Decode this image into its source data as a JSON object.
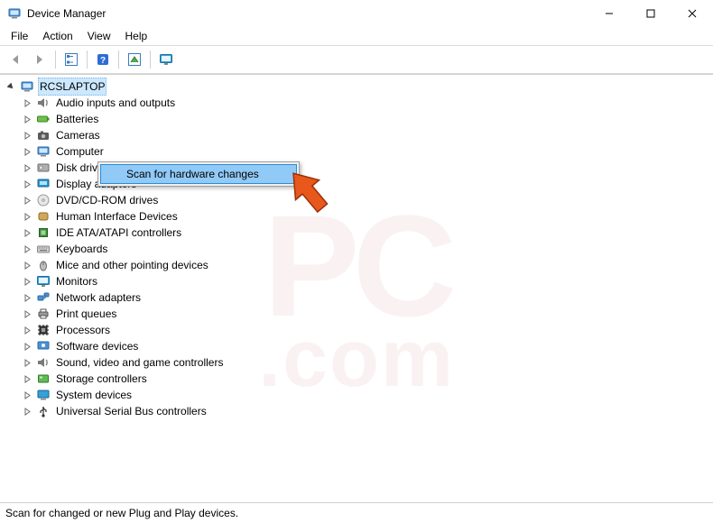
{
  "window": {
    "title": "Device Manager"
  },
  "menu": {
    "file": "File",
    "action": "Action",
    "view": "View",
    "help": "Help"
  },
  "toolbar": {
    "back": "back",
    "forward": "forward",
    "show_hide": "show-hide-tree",
    "help": "help",
    "scan": "scan-hardware",
    "monitor": "add-legacy"
  },
  "tree": {
    "root": "RCSLAPTOP",
    "items": [
      {
        "label": "Audio inputs and outputs",
        "icon": "speaker-icon"
      },
      {
        "label": "Batteries",
        "icon": "battery-icon"
      },
      {
        "label": "Cameras",
        "icon": "camera-icon"
      },
      {
        "label": "Computer",
        "icon": "computer-icon"
      },
      {
        "label": "Disk drives",
        "icon": "disk-icon"
      },
      {
        "label": "Display adapters",
        "icon": "display-adapter-icon"
      },
      {
        "label": "DVD/CD-ROM drives",
        "icon": "optical-drive-icon"
      },
      {
        "label": "Human Interface Devices",
        "icon": "hid-icon"
      },
      {
        "label": "IDE ATA/ATAPI controllers",
        "icon": "ide-controller-icon"
      },
      {
        "label": "Keyboards",
        "icon": "keyboard-icon"
      },
      {
        "label": "Mice and other pointing devices",
        "icon": "mouse-icon"
      },
      {
        "label": "Monitors",
        "icon": "monitor-icon"
      },
      {
        "label": "Network adapters",
        "icon": "network-adapter-icon"
      },
      {
        "label": "Print queues",
        "icon": "printer-icon"
      },
      {
        "label": "Processors",
        "icon": "processor-icon"
      },
      {
        "label": "Software devices",
        "icon": "software-device-icon"
      },
      {
        "label": "Sound, video and game controllers",
        "icon": "sound-controller-icon"
      },
      {
        "label": "Storage controllers",
        "icon": "storage-controller-icon"
      },
      {
        "label": "System devices",
        "icon": "system-device-icon"
      },
      {
        "label": "Universal Serial Bus controllers",
        "icon": "usb-icon"
      }
    ]
  },
  "context_menu": {
    "scan": "Scan for hardware changes"
  },
  "statusbar": {
    "text": "Scan for changed or new Plug and Play devices."
  },
  "watermark": {
    "top": "PC",
    "bottom": ".com"
  },
  "colors": {
    "selection": "#cce8ff",
    "menu_highlight": "#91c9f7",
    "arrow": "#e8571c"
  }
}
